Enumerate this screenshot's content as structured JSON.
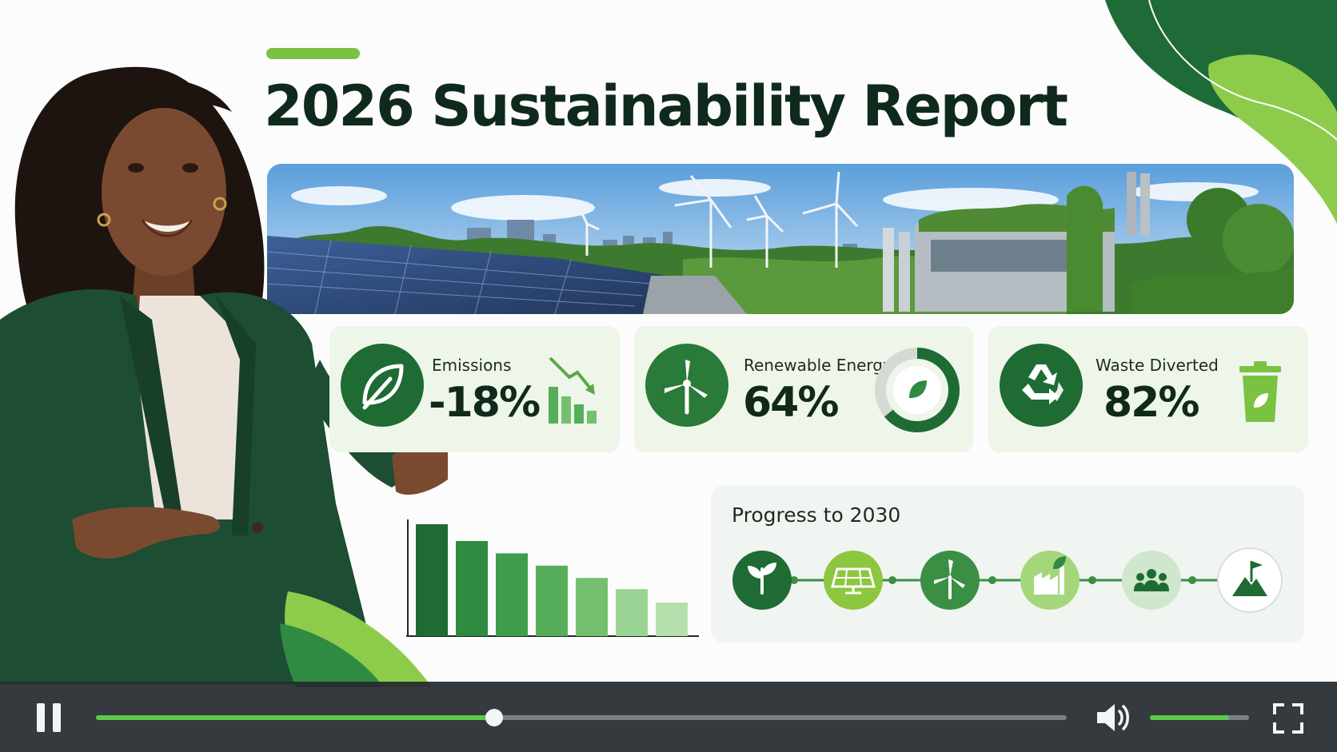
{
  "report": {
    "title": "2026 Sustainability Report"
  },
  "kpis": [
    {
      "label": "Emissions",
      "value": "-18%",
      "icon": "leaf-icon",
      "side_icon": "declining-bar-chart-icon"
    },
    {
      "label": "Renewable Energy",
      "value": "64%",
      "icon": "wind-turbine-icon",
      "side_icon": "donut-gauge-icon",
      "gauge_fraction": 0.64
    },
    {
      "label": "Waste Diverted",
      "value": "82%",
      "icon": "recycle-icon",
      "side_icon": "recycle-bin-icon"
    }
  ],
  "chart_data": {
    "type": "bar",
    "values": [
      100,
      85,
      74,
      63,
      52,
      42,
      30
    ],
    "ylim": [
      0,
      100
    ],
    "colors": [
      "#1e6b34",
      "#2f8a42",
      "#3f9e4d",
      "#56ae5b",
      "#74c06f",
      "#9ad494",
      "#b5e0ad"
    ]
  },
  "progress": {
    "title": "Progress to 2030",
    "milestones": [
      {
        "icon": "sprout-icon",
        "color": "#1e6b34"
      },
      {
        "icon": "solar-panel-icon",
        "color": "#8dc63f"
      },
      {
        "icon": "wind-turbine-icon",
        "color": "#3a8f45"
      },
      {
        "icon": "green-factory-icon",
        "color": "#a5d67c"
      },
      {
        "icon": "people-icon",
        "color": "#cfe7cc"
      },
      {
        "icon": "summit-flag-icon",
        "color": "#ffffff"
      }
    ]
  },
  "player": {
    "state": "playing",
    "progress_fraction": 0.41,
    "volume_fraction": 0.8,
    "accent": "#5cc94c"
  }
}
